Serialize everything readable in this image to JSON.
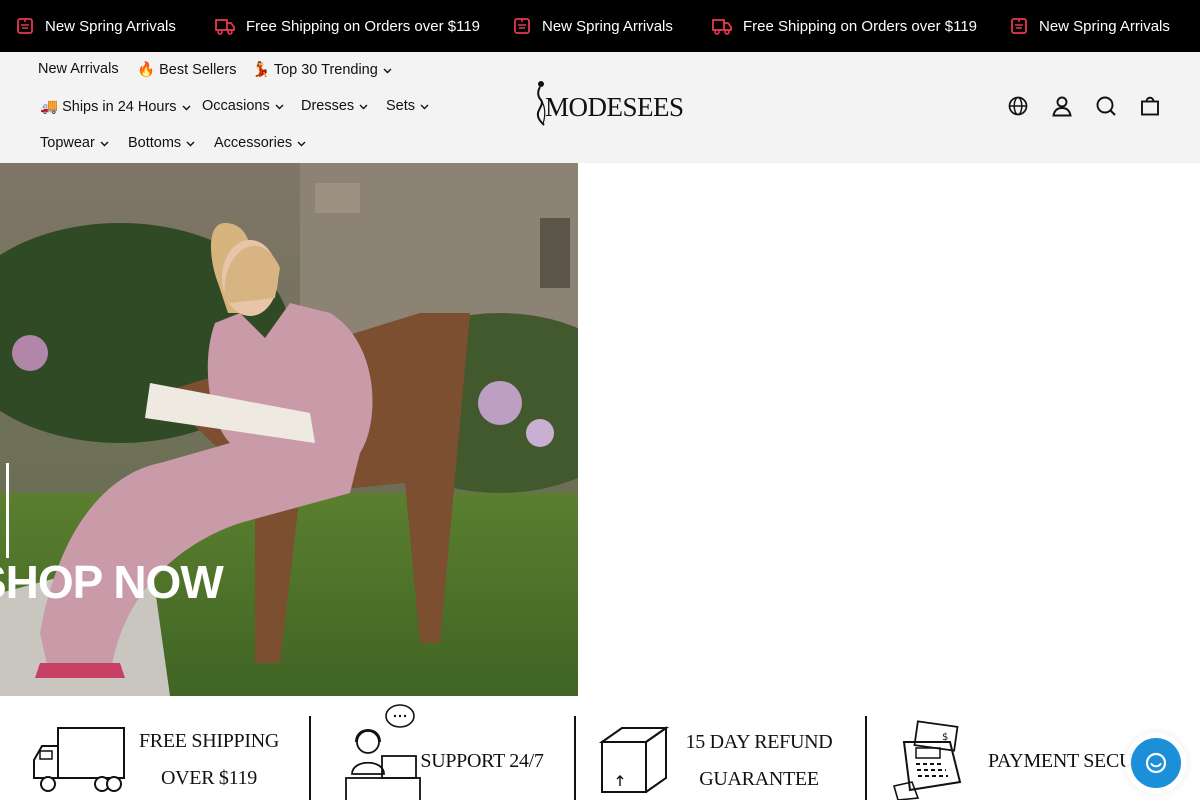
{
  "announcement": {
    "items": [
      {
        "label": "New Spring Arrivals",
        "icon": "ticket-icon"
      },
      {
        "label": "Free Shipping on Orders over $119",
        "icon": "truck-icon"
      },
      {
        "label": "New Spring Arrivals",
        "icon": "ticket-icon"
      },
      {
        "label": "Free Shipping on Orders over $119",
        "icon": "truck-icon"
      },
      {
        "label": "New Spring Arrivals",
        "icon": "ticket-icon"
      }
    ],
    "icon_color": "#e8384f"
  },
  "nav": {
    "new_arrivals": "New Arrivals",
    "best_sellers": "🔥 Best Sellers",
    "top_trending": "💃 Top 30 Trending",
    "ships_24": "🚚 Ships in 24 Hours",
    "occasions": "Occasions",
    "dresses": "Dresses",
    "sets": "Sets",
    "topwear": "Topwear",
    "bottoms": "Bottoms",
    "accessories": "Accessories"
  },
  "logo": {
    "text": "MODESEES"
  },
  "header_icons": [
    "globe-icon",
    "account-icon",
    "search-icon",
    "cart-icon"
  ],
  "hero": {
    "cta": "SHOP NOW"
  },
  "features": {
    "shipping_line1": "FREE SHIPPING",
    "shipping_line2": "OVER $119",
    "support": "SUPPORT  24/7",
    "refund_line1": "15 DAY REFUND",
    "refund_line2": "GUARANTEE",
    "payment": "PAYMENT SECURE"
  },
  "colors": {
    "brand_dark": "#000000",
    "header_bg": "#f3f3f3",
    "chat": "#1b8fd8"
  }
}
